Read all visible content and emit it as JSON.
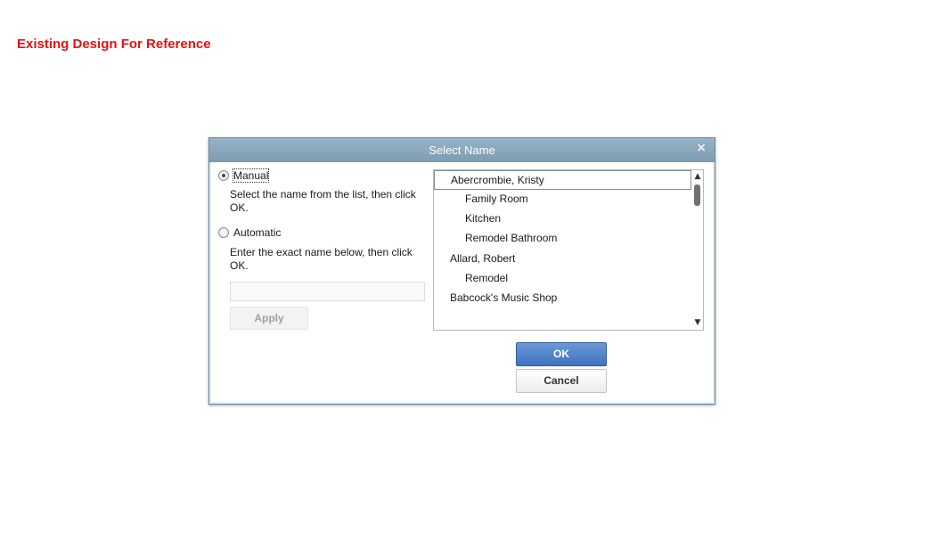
{
  "reference_title": "Existing Design For Reference",
  "dialog": {
    "title": "Select Name",
    "close_glyph": "×",
    "manual": {
      "label": "Manual",
      "checked": true,
      "help": "Select the name from the list, then click OK."
    },
    "automatic": {
      "label": "Automatic",
      "checked": false,
      "help": "Enter the exact name below, then click OK."
    },
    "name_input": {
      "value": "",
      "placeholder": ""
    },
    "apply_label": "Apply",
    "list": {
      "items": [
        {
          "label": "Abercrombie, Kristy",
          "level": 0,
          "selected": true
        },
        {
          "label": "Family Room",
          "level": 1
        },
        {
          "label": "Kitchen",
          "level": 1
        },
        {
          "label": "Remodel Bathroom",
          "level": 1
        },
        {
          "label": "Allard, Robert",
          "level": 0
        },
        {
          "label": "Remodel",
          "level": 1
        },
        {
          "label": "Babcock's Music Shop",
          "level": 0
        }
      ]
    },
    "scroll_up_glyph": "▲",
    "scroll_down_glyph": "▼",
    "ok_label": "OK",
    "cancel_label": "Cancel"
  },
  "icons": {
    "close": "close-icon",
    "scroll_up": "scroll-up-arrow-icon",
    "scroll_down": "scroll-down-arrow-icon"
  }
}
